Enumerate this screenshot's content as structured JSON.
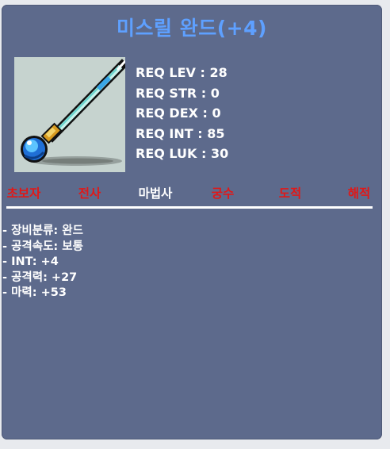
{
  "item": {
    "name": "미스릴 완드(+4)",
    "icon": "mithril-wand-icon"
  },
  "requirements": [
    {
      "label": "REQ LEV",
      "value": "28",
      "text": "REQ LEV : 28"
    },
    {
      "label": "REQ STR",
      "value": "0",
      "text": "REQ STR : 0"
    },
    {
      "label": "REQ DEX",
      "value": "0",
      "text": "REQ DEX : 0"
    },
    {
      "label": "REQ INT",
      "value": "85",
      "text": "REQ INT : 85"
    },
    {
      "label": "REQ LUK",
      "value": "30",
      "text": "REQ LUK : 30"
    }
  ],
  "jobs": [
    {
      "label": "초보자",
      "available": false
    },
    {
      "label": "전사",
      "available": false
    },
    {
      "label": "마법사",
      "available": true
    },
    {
      "label": "궁수",
      "available": false
    },
    {
      "label": "도적",
      "available": false
    },
    {
      "label": "해적",
      "available": false
    }
  ],
  "stats": [
    "- 장비분류: 완드",
    "- 공격속도: 보통",
    "- INT: +4",
    "- 공격력: +27",
    "- 마력: +53"
  ],
  "colors": {
    "title": "#5ea0ff",
    "panel": "#5d6a8c",
    "job_unavailable": "#e01818",
    "job_available": "#ffffff"
  }
}
